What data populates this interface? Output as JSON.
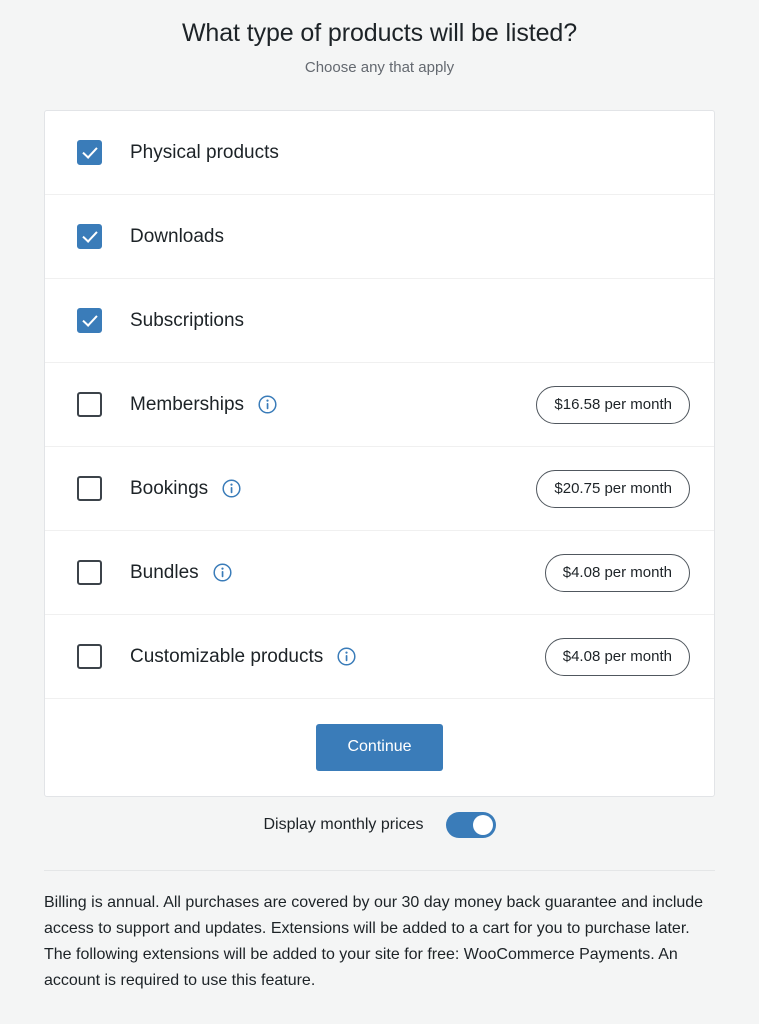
{
  "header": {
    "title": "What type of products will be listed?",
    "subtitle": "Choose any that apply"
  },
  "options": [
    {
      "label": "Physical products",
      "checked": true,
      "has_info": false,
      "price": ""
    },
    {
      "label": "Downloads",
      "checked": true,
      "has_info": false,
      "price": ""
    },
    {
      "label": "Subscriptions",
      "checked": true,
      "has_info": false,
      "price": ""
    },
    {
      "label": "Memberships",
      "checked": false,
      "has_info": true,
      "price": "$16.58 per month"
    },
    {
      "label": "Bookings",
      "checked": false,
      "has_info": true,
      "price": "$20.75 per month"
    },
    {
      "label": "Bundles",
      "checked": false,
      "has_info": true,
      "price": "$4.08 per month"
    },
    {
      "label": "Customizable products",
      "checked": false,
      "has_info": true,
      "price": "$4.08 per month"
    }
  ],
  "actions": {
    "continue_label": "Continue"
  },
  "toggle": {
    "label": "Display monthly prices",
    "on": true
  },
  "footer": {
    "paragraph1": "Billing is annual. All purchases are covered by our 30 day money back guarantee and include access to support and updates. Extensions will be added to a cart for you to purchase later.",
    "paragraph2": "The following extensions will be added to your site for free: WooCommerce Payments. An account is required to use this feature."
  },
  "icons": {
    "info": "info-icon",
    "checkmark": "check-icon"
  },
  "colors": {
    "accent": "#3a7cb9",
    "background": "#f4f5f5",
    "card": "#ffffff",
    "text": "#1d2327",
    "muted_text": "#646970",
    "pill_border": "#50575e",
    "row_divider": "#f0f0f0"
  }
}
